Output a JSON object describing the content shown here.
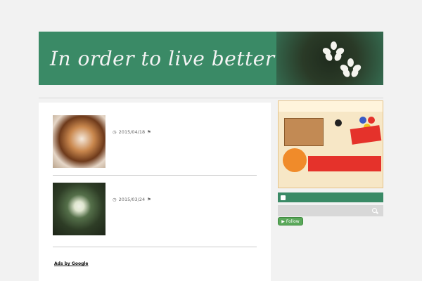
{
  "site": {
    "title": "",
    "description": "",
    "banner_text": "In order to live better"
  },
  "nav": {
    "items": [
      {
        "label": ""
      },
      {
        "label": ""
      },
      {
        "label": ""
      },
      {
        "label": ""
      },
      {
        "label": ""
      },
      {
        "label": ""
      },
      {
        "label": ""
      },
      {
        "label": ""
      },
      {
        "label": ""
      },
      {
        "label": ""
      }
    ]
  },
  "posts": [
    {
      "title": "",
      "date": "2015/04/18",
      "category": "",
      "excerpt": ""
    },
    {
      "title": "",
      "date": "2015/03/24",
      "category": "",
      "excerpt": ""
    }
  ],
  "ads": {
    "label": "",
    "ads_by": "Ads by Google",
    "links": [
      ""
    ]
  },
  "sidebar": {
    "ad": {
      "brand": "",
      "sticker": "",
      "subtitle": "",
      "banner": "",
      "corner": "",
      "categories": [
        "",
        "",
        "",
        "",
        ""
      ]
    },
    "rss_label": "",
    "search_placeholder": "",
    "follow_label": "Follow",
    "recent_title": "",
    "recent_posts": [
      "",
      "",
      "",
      ""
    ]
  },
  "colors": {
    "accent": "#3a8a66",
    "link": "#1a4a9a"
  },
  "icons": {
    "clock": "clock-icon",
    "tag": "tag-icon",
    "rss": "rss-icon",
    "search": "search-icon"
  }
}
